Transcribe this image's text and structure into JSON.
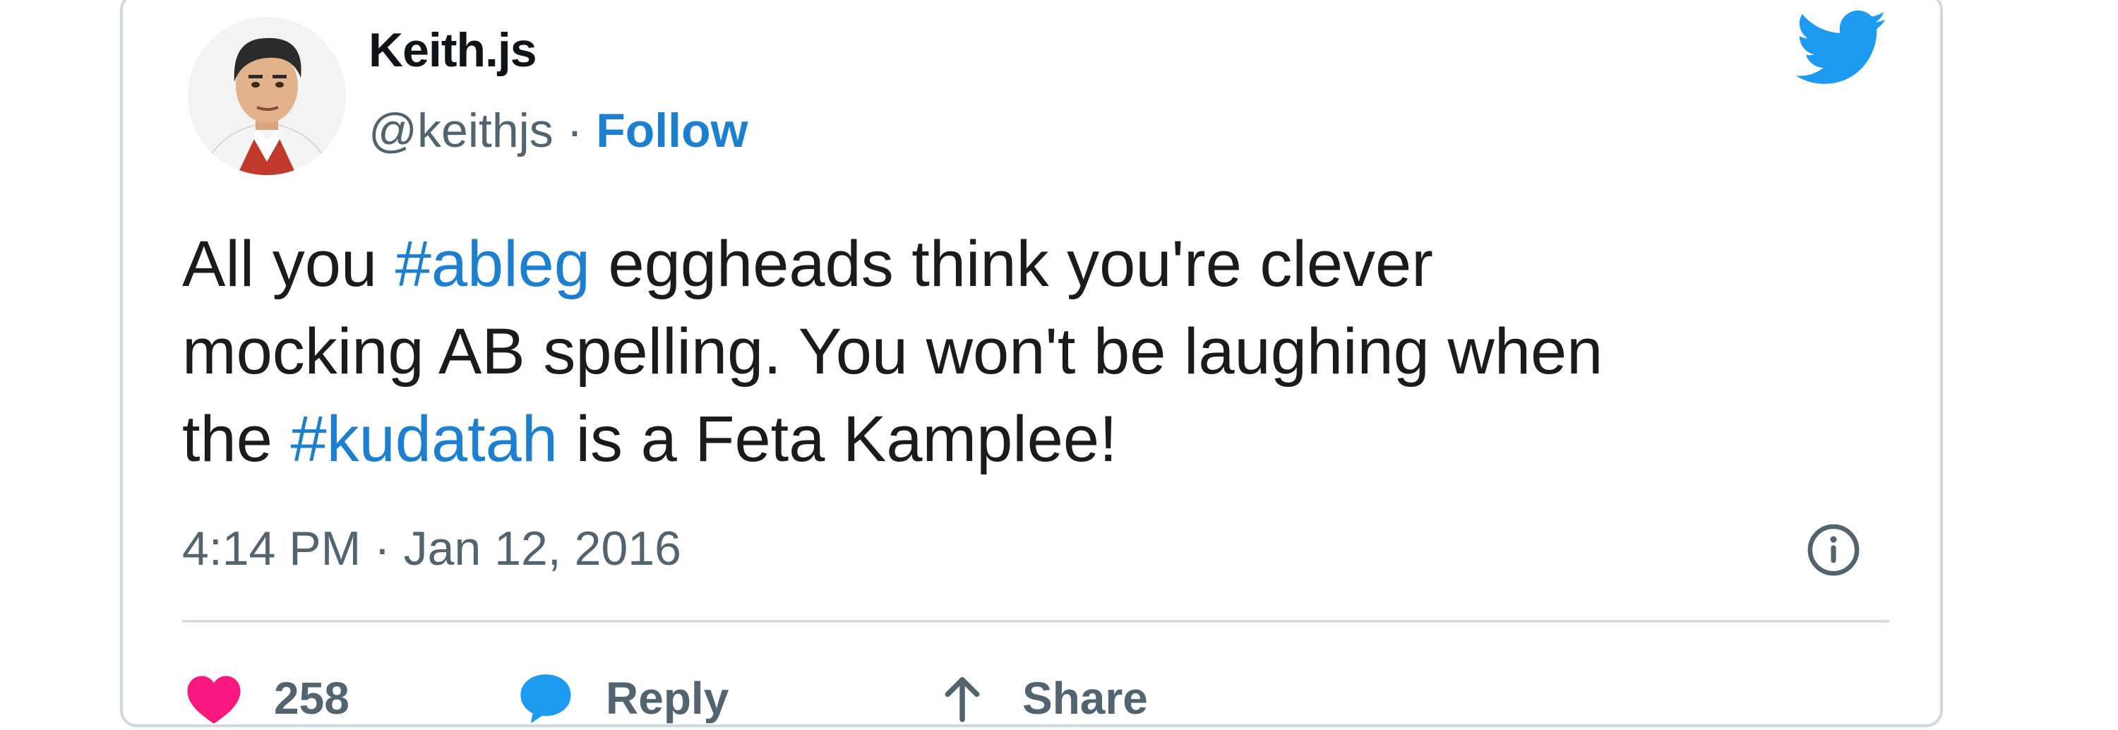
{
  "tweet": {
    "display_name": "Keith.js",
    "handle": "@keithjs",
    "separator": " · ",
    "follow_label": "Follow",
    "text_lines": [
      [
        {
          "t": "All you ",
          "tag": false
        },
        {
          "t": "#ableg",
          "tag": true
        },
        {
          "t": " eggheads think you're clever",
          "tag": false
        }
      ],
      [
        {
          "t": "mocking AB spelling. You won't be laughing when",
          "tag": false
        }
      ],
      [
        {
          "t": "the ",
          "tag": false
        },
        {
          "t": "#kudatah",
          "tag": true
        },
        {
          "t": " is a Feta Kamplee!",
          "tag": false
        }
      ]
    ],
    "time": "4:14 PM",
    "date": "Jan 12, 2016",
    "timestamp": "4:14 PM · Jan 12, 2016"
  },
  "actions": {
    "like_count": "258",
    "reply_label": "Reply",
    "share_label": "Share"
  },
  "icons": {
    "brand": "twitter-bird-icon",
    "info": "info-icon",
    "like": "heart-icon",
    "reply": "reply-bubble-icon",
    "share": "share-arrow-icon"
  },
  "colors": {
    "link_blue": "#1d7fd0",
    "twitter_blue": "#1d9bf0",
    "like_pink": "#f91880",
    "muted_text": "#536471",
    "border": "#cfd9de"
  }
}
